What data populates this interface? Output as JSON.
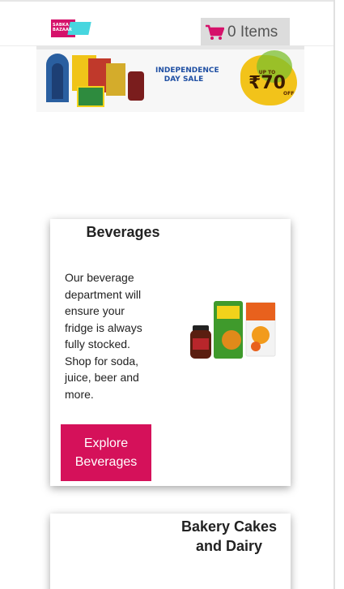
{
  "header": {
    "logo_text": "SABKA BAZAAR",
    "cart": {
      "count_label": "0 Items",
      "icon": "shopping-cart-icon",
      "icon_color": "#d5116a"
    }
  },
  "banner": {
    "title_line1": "INDEPENDENCE",
    "title_line2": "DAY SALE",
    "offer_prefix": "UP TO",
    "offer_value": "₹70",
    "offer_suffix": "OFF"
  },
  "categories": [
    {
      "title": "Beverages",
      "description": "Our beverage department will ensure your fridge is always fully stocked. Shop for soda, juice, beer and more.",
      "button_label": "Explore Beverages",
      "button_color": "#d5115a"
    },
    {
      "title": "Bakery Cakes and Dairy"
    }
  ]
}
